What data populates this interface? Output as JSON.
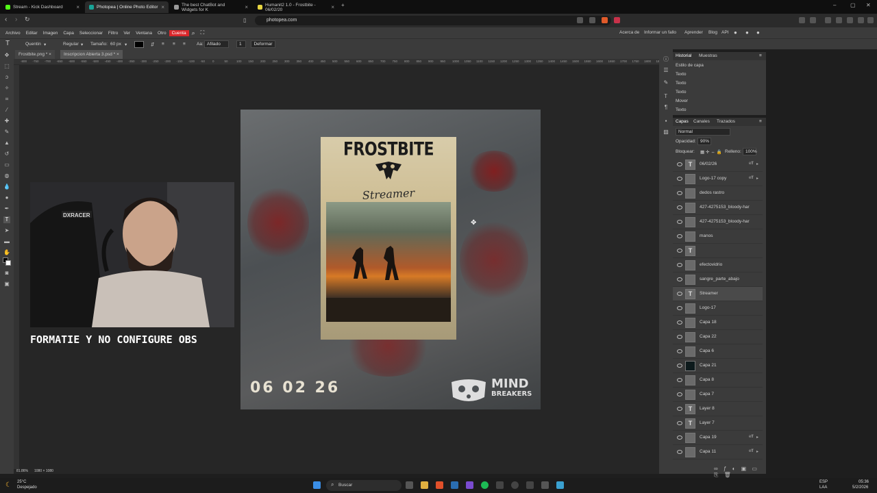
{
  "browser": {
    "tabs": [
      {
        "label": "Stream - Kick Dashboard",
        "color": "#53fc18"
      },
      {
        "label": "Photopea | Online Photo Editor",
        "color": "#18a497"
      },
      {
        "label": "The best ChatBot and Widgets for K",
        "color": "#9b9b9b"
      },
      {
        "label": "Humanit2 1.0 - Frostbite - 06/02/20",
        "color": "#e7d541"
      }
    ],
    "url": "photopea.com"
  },
  "menubar": {
    "items": [
      "Archivo",
      "Editar",
      "Imagen",
      "Capa",
      "Seleccionar",
      "Filtro",
      "Ver",
      "Ventana",
      "Otro",
      "Cuenta"
    ],
    "right_items": [
      "Acerca de",
      "Informar un fallo",
      "Aprender",
      "Blog",
      "API"
    ]
  },
  "options": {
    "font": "Quentin",
    "style": "Regular",
    "size_label": "Tamaño:",
    "size_value": "60 px",
    "aa_label": "Aa:",
    "aa_value": "Afilado",
    "warp_button": "Deformar"
  },
  "documents": {
    "tabs": [
      "Frostbite.png *",
      "Inscripcion Abierta 3.psd *"
    ]
  },
  "ruler_ticks": [
    "-800",
    "-750",
    "-700",
    "-650",
    "-600",
    "-550",
    "-500",
    "-450",
    "-400",
    "-350",
    "-300",
    "-250",
    "-200",
    "-150",
    "-100",
    "-50",
    "0",
    "50",
    "100",
    "150",
    "200",
    "250",
    "300",
    "350",
    "400",
    "450",
    "500",
    "550",
    "600",
    "650",
    "700",
    "750",
    "800",
    "850",
    "900",
    "950",
    "1000",
    "1050",
    "1100",
    "1150",
    "1200",
    "1250",
    "1300",
    "1350",
    "1400",
    "1450",
    "1500",
    "1550",
    "1600",
    "1650",
    "1700",
    "1750",
    "1800",
    "1850"
  ],
  "poster": {
    "title": "FROSTBITE",
    "subtitle": "Streamer",
    "date": "06 02 26",
    "brand_line1": "MIND",
    "brand_line2": "BREAKERS"
  },
  "overlay": {
    "caption": "FORMATIE Y NO CONFIGURE OBS",
    "chair_brand": "DXRACER"
  },
  "history_panel": {
    "tabs": [
      "Historial",
      "Muestras"
    ],
    "items": [
      "Estilo de capa",
      "Texto",
      "Texto",
      "Texto",
      "Mover",
      "Texto"
    ]
  },
  "layers_panel": {
    "tabs": [
      "Capas",
      "Canales",
      "Trazados"
    ],
    "blend_mode": "Normal",
    "opacity_label": "Opacidad:",
    "opacity_value": "90%",
    "lock_label": "Bloquear:",
    "fill_label": "Relleno:",
    "fill_value": "100%",
    "layers": [
      {
        "name": "06/02/26",
        "type": "T",
        "fx": "eff"
      },
      {
        "name": "Logo-17 copy",
        "type": "",
        "fx": "eff"
      },
      {
        "name": "dedos rastro",
        "type": "",
        "fx": ""
      },
      {
        "name": "427-4275153_bloody-har",
        "type": "",
        "fx": ""
      },
      {
        "name": "427-4275153_bloody-har",
        "type": "",
        "fx": ""
      },
      {
        "name": "manos",
        "type": "",
        "fx": ""
      },
      {
        "name": "",
        "type": "T",
        "fx": ""
      },
      {
        "name": "efectovidrio",
        "type": "",
        "fx": ""
      },
      {
        "name": "sangre_parte_abajo",
        "type": "",
        "fx": ""
      },
      {
        "name": "Streamer",
        "type": "T",
        "fx": ""
      },
      {
        "name": "Logo-17",
        "type": "",
        "fx": ""
      },
      {
        "name": "Capa 18",
        "type": "",
        "fx": ""
      },
      {
        "name": "Capa 22",
        "type": "",
        "fx": ""
      },
      {
        "name": "Capa 6",
        "type": "",
        "fx": ""
      },
      {
        "name": "Capa 21",
        "type": "",
        "fx": ""
      },
      {
        "name": "Capa 8",
        "type": "",
        "fx": ""
      },
      {
        "name": "Capa 7",
        "type": "",
        "fx": ""
      },
      {
        "name": "Layer 8",
        "type": "T",
        "fx": ""
      },
      {
        "name": "Layer 7",
        "type": "T",
        "fx": ""
      },
      {
        "name": "Capa 19",
        "type": "",
        "fx": "eff"
      },
      {
        "name": "Capa 11",
        "type": "",
        "fx": "eff"
      }
    ]
  },
  "status": {
    "zoom": "81.86%",
    "dims": "1080 × 1080"
  },
  "taskbar": {
    "weather_temp": "25°C",
    "weather_desc": "Despejado",
    "search": "Buscar",
    "lang1": "ESP",
    "lang2": "LAA",
    "time": "05:36",
    "date": "5/2/2026"
  }
}
